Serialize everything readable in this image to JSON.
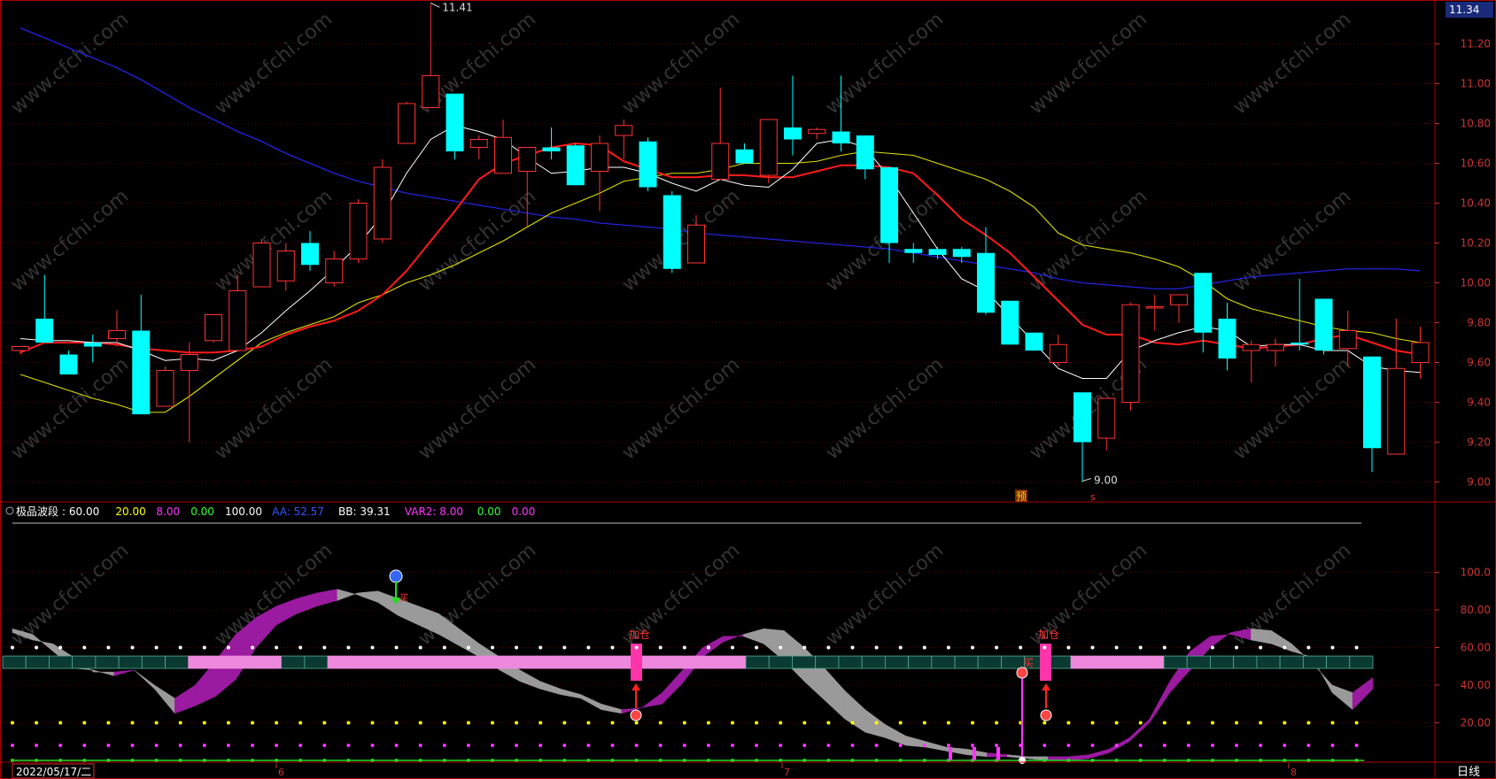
{
  "colors": {
    "up": "#ff3232",
    "down": "#00ffff",
    "ma5": "#ffffff",
    "ma10": "#ff1a1a",
    "ma20": "#e0e000",
    "ma60": "#2222dd",
    "frame": "#aa0000",
    "purple": "#9a1aa0",
    "gray": "#9a9a9a",
    "pink": "#ee88dd",
    "teal": "#0a3a30",
    "yellow": "#ffff00",
    "magenta": "#ff33ff",
    "green": "#22dd22",
    "axis": "#cc3333"
  },
  "price_axis": {
    "badge": "11.34",
    "ticks": [
      "11.20",
      "11.00",
      "10.80",
      "10.60",
      "10.40",
      "10.20",
      "10.00",
      "9.80",
      "9.60",
      "9.40",
      "9.20",
      "9.00"
    ],
    "high_label": "11.41",
    "low_label": "9.00",
    "marker_yu": "预",
    "marker_s": "s"
  },
  "indicator": {
    "title": "极品波段",
    "values": [
      {
        "text": "60.00",
        "color": "#ffffff"
      },
      {
        "text": "20.00",
        "color": "#ffff00"
      },
      {
        "text": "8.00",
        "color": "#ff33ff"
      },
      {
        "text": "0.00",
        "color": "#33ff33"
      },
      {
        "text": "100.00",
        "color": "#ffffff"
      },
      {
        "text": "AA: 52.57",
        "color": "#3355ff"
      },
      {
        "text": "BB: 39.31",
        "color": "#ffffff"
      },
      {
        "text": "VAR2: 8.00",
        "color": "#ff33ff"
      },
      {
        "text": "0.00",
        "color": "#33ff33"
      },
      {
        "text": "0.00",
        "color": "#ff33ff"
      }
    ],
    "axis_ticks": [
      "100.0",
      "80.00",
      "60.00",
      "40.00",
      "20.00"
    ],
    "labels": {
      "jiacang1": "加仓",
      "jiacang2": "加仓",
      "mai": "买",
      "mai_small": "买"
    }
  },
  "bottom_bar": {
    "date": "2022/05/17/二",
    "period": "日线",
    "months": [
      "6",
      "7",
      "8"
    ]
  },
  "watermark": "www.cfchi.com",
  "chart_data": {
    "type": "candlestick",
    "ylim": [
      8.95,
      11.43
    ],
    "candles": [
      [
        9.66,
        9.68,
        9.64,
        9.68
      ],
      [
        9.82,
        9.7,
        9.7,
        10.04
      ],
      [
        9.64,
        9.54,
        9.54,
        9.66
      ],
      [
        9.7,
        9.68,
        9.6,
        9.74
      ],
      [
        9.72,
        9.76,
        9.68,
        9.86
      ],
      [
        9.76,
        9.34,
        9.34,
        9.94
      ],
      [
        9.38,
        9.56,
        9.38,
        9.58
      ],
      [
        9.56,
        9.64,
        9.2,
        9.7
      ],
      [
        9.71,
        9.84,
        9.7,
        9.84
      ],
      [
        9.66,
        9.96,
        9.66,
        10.04
      ],
      [
        9.98,
        10.2,
        9.98,
        10.22
      ],
      [
        10.01,
        10.16,
        9.96,
        10.2
      ],
      [
        10.2,
        10.09,
        10.06,
        10.26
      ],
      [
        10.0,
        10.12,
        9.98,
        10.16
      ],
      [
        10.12,
        10.4,
        10.1,
        10.42
      ],
      [
        10.22,
        10.58,
        10.2,
        10.62
      ],
      [
        10.7,
        10.9,
        10.7,
        10.91
      ],
      [
        10.88,
        11.04,
        10.88,
        11.4
      ],
      [
        10.95,
        10.66,
        10.62,
        10.95
      ],
      [
        10.68,
        10.72,
        10.62,
        10.74
      ],
      [
        10.55,
        10.73,
        10.55,
        10.82
      ],
      [
        10.56,
        10.68,
        10.28,
        10.68
      ],
      [
        10.68,
        10.66,
        10.62,
        10.78
      ],
      [
        10.69,
        10.49,
        10.49,
        10.7
      ],
      [
        10.56,
        10.7,
        10.36,
        10.74
      ],
      [
        10.74,
        10.79,
        10.62,
        10.82
      ],
      [
        10.71,
        10.48,
        10.46,
        10.73
      ],
      [
        10.44,
        10.07,
        10.05,
        10.46
      ],
      [
        10.1,
        10.29,
        10.1,
        10.34
      ],
      [
        10.52,
        10.7,
        10.52,
        10.98
      ],
      [
        10.67,
        10.6,
        10.6,
        10.7
      ],
      [
        10.54,
        10.82,
        10.5,
        10.82
      ],
      [
        10.78,
        10.72,
        10.64,
        11.04
      ],
      [
        10.75,
        10.77,
        10.72,
        10.78
      ],
      [
        10.76,
        10.7,
        10.66,
        11.04
      ],
      [
        10.74,
        10.57,
        10.52,
        10.74
      ],
      [
        10.58,
        10.2,
        10.1,
        10.58
      ],
      [
        10.17,
        10.15,
        10.1,
        10.2
      ],
      [
        10.17,
        10.14,
        10.12,
        10.18
      ],
      [
        10.17,
        10.13,
        10.1,
        10.18
      ],
      [
        10.15,
        9.85,
        9.84,
        10.28
      ],
      [
        9.91,
        9.69,
        9.69,
        9.91
      ],
      [
        9.75,
        9.66,
        9.66,
        9.75
      ],
      [
        9.6,
        9.69,
        9.58,
        9.74
      ],
      [
        9.45,
        9.2,
        9.0,
        9.45
      ],
      [
        9.22,
        9.42,
        9.16,
        9.42
      ],
      [
        9.4,
        9.89,
        9.36,
        9.9
      ],
      [
        9.88,
        9.88,
        9.76,
        9.94
      ],
      [
        9.89,
        9.94,
        9.8,
        9.94
      ],
      [
        10.05,
        9.75,
        9.65,
        10.05
      ],
      [
        9.82,
        9.62,
        9.56,
        9.9
      ],
      [
        9.66,
        9.69,
        9.5,
        9.71
      ],
      [
        9.66,
        9.69,
        9.58,
        9.72
      ],
      [
        9.7,
        9.69,
        9.66,
        10.02
      ],
      [
        9.92,
        9.66,
        9.64,
        9.92
      ],
      [
        9.67,
        9.76,
        9.58,
        9.86
      ],
      [
        9.63,
        9.17,
        9.05,
        9.63
      ],
      [
        9.14,
        9.57,
        9.14,
        9.82
      ],
      [
        9.6,
        9.7,
        9.52,
        9.78
      ]
    ],
    "ma5": [
      9.72,
      9.71,
      9.71,
      9.7,
      9.7,
      9.66,
      9.61,
      9.62,
      9.61,
      9.66,
      9.75,
      9.86,
      9.96,
      10.07,
      10.19,
      10.34,
      10.55,
      10.72,
      10.79,
      10.76,
      10.72,
      10.63,
      10.55,
      10.56,
      10.58,
      10.58,
      10.55,
      10.5,
      10.46,
      10.52,
      10.49,
      10.48,
      10.57,
      10.7,
      10.72,
      10.68,
      10.53,
      10.35,
      10.17,
      10.02,
      9.96,
      9.83,
      9.7,
      9.57,
      9.52,
      9.52,
      9.66,
      9.71,
      9.75,
      9.78,
      9.76,
      9.68,
      9.69,
      9.69,
      9.66,
      9.66,
      9.58,
      9.56,
      9.55
    ],
    "ma10": [
      9.65,
      9.7,
      9.7,
      9.7,
      9.69,
      9.67,
      9.66,
      9.65,
      9.65,
      9.66,
      9.68,
      9.74,
      9.78,
      9.81,
      9.86,
      9.94,
      10.06,
      10.21,
      10.36,
      10.52,
      10.6,
      10.64,
      10.68,
      10.7,
      10.69,
      10.61,
      10.57,
      10.53,
      10.53,
      10.54,
      10.54,
      10.53,
      10.53,
      10.56,
      10.59,
      10.59,
      10.58,
      10.55,
      10.44,
      10.32,
      10.24,
      10.15,
      10.03,
      9.91,
      9.79,
      9.74,
      9.74,
      9.7,
      9.69,
      9.71,
      9.69,
      9.67,
      9.68,
      9.69,
      9.72,
      9.74,
      9.7,
      9.66,
      9.64
    ],
    "ma20": [
      9.54,
      9.5,
      9.46,
      9.42,
      9.39,
      9.35,
      9.35,
      9.43,
      9.52,
      9.61,
      9.7,
      9.75,
      9.79,
      9.83,
      9.9,
      9.94,
      10.0,
      10.04,
      10.09,
      10.15,
      10.21,
      10.28,
      10.35,
      10.4,
      10.45,
      10.51,
      10.53,
      10.55,
      10.55,
      10.57,
      10.6,
      10.6,
      10.6,
      10.61,
      10.64,
      10.66,
      10.65,
      10.64,
      10.6,
      10.56,
      10.52,
      10.46,
      10.38,
      10.25,
      10.19,
      10.17,
      10.15,
      10.12,
      10.08,
      10.01,
      9.92,
      9.87,
      9.84,
      9.81,
      9.78,
      9.76,
      9.75,
      9.72,
      9.7
    ],
    "ma60": [
      11.28,
      11.23,
      11.18,
      11.13,
      11.08,
      11.02,
      10.95,
      10.88,
      10.82,
      10.76,
      10.71,
      10.65,
      10.6,
      10.55,
      10.51,
      10.48,
      10.45,
      10.43,
      10.41,
      10.39,
      10.37,
      10.35,
      10.33,
      10.32,
      10.3,
      10.29,
      10.28,
      10.27,
      10.25,
      10.24,
      10.23,
      10.22,
      10.21,
      10.2,
      10.19,
      10.18,
      10.17,
      10.15,
      10.13,
      10.11,
      10.09,
      10.07,
      10.05,
      10.02,
      10.0,
      9.99,
      9.98,
      9.97,
      9.97,
      9.99,
      10.01,
      10.03,
      10.04,
      10.05,
      10.06,
      10.07,
      10.07,
      10.07,
      10.06
    ],
    "indicator_ylim": [
      0,
      100
    ],
    "aa": [
      70,
      67,
      58,
      49,
      48,
      45,
      48,
      40,
      33,
      40,
      53,
      67,
      76,
      82,
      86,
      89,
      91,
      88,
      84,
      77,
      72,
      67,
      61,
      55,
      48,
      42,
      38,
      35,
      33,
      27,
      25,
      28,
      36,
      48,
      60,
      66,
      66,
      62,
      53,
      42,
      32,
      22,
      15,
      12,
      8,
      7,
      5,
      3,
      2,
      2,
      1,
      0,
      0,
      1,
      4,
      10,
      20,
      36,
      48,
      60,
      68,
      70,
      69,
      62,
      52,
      40,
      36,
      44
    ],
    "bb": [
      68,
      64,
      62,
      55,
      47,
      47,
      48,
      38,
      25,
      29,
      34,
      43,
      60,
      72,
      78,
      82,
      85,
      89,
      90,
      86,
      82,
      78,
      70,
      62,
      55,
      48,
      42,
      38,
      35,
      30,
      27,
      28,
      30,
      41,
      55,
      63,
      67,
      70,
      69,
      60,
      49,
      37,
      27,
      19,
      13,
      10,
      7,
      6,
      4,
      3,
      2,
      2,
      2,
      3,
      6,
      12,
      22,
      42,
      58,
      66,
      67,
      64,
      62,
      58,
      55,
      36,
      27,
      38
    ],
    "band_pink_ranges": [
      [
        4,
        5
      ],
      [
        7,
        15
      ],
      [
        23,
        24
      ],
      [
        32,
        33
      ],
      [
        41,
        46
      ],
      [
        51,
        52
      ],
      [
        55,
        56
      ]
    ],
    "jiacang_idx": [
      26,
      43
    ],
    "dot_levels": [
      60,
      20,
      8,
      0
    ]
  }
}
